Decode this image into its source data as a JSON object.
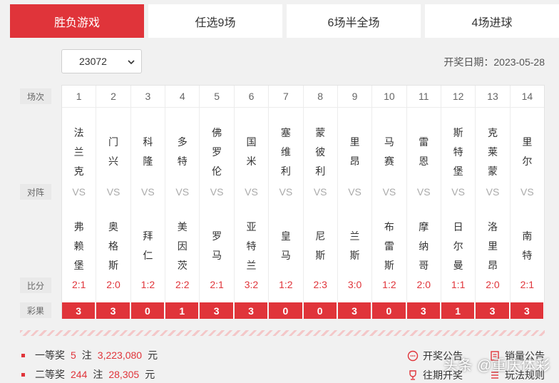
{
  "tabs": [
    {
      "label": "胜负游戏",
      "active": true
    },
    {
      "label": "任选9场",
      "active": false
    },
    {
      "label": "6场半全场",
      "active": false
    },
    {
      "label": "4场进球",
      "active": false
    }
  ],
  "issue": {
    "selected": "23072"
  },
  "draw_date": "开奖日期：2023-05-28",
  "row_labels": {
    "match_no": "场次",
    "matchup": "对阵",
    "score": "比分",
    "result": "彩果"
  },
  "vs_text": "VS",
  "matches": [
    {
      "no": "1",
      "home": "法兰克",
      "away": "弗赖堡",
      "score": "2:1",
      "result": "3"
    },
    {
      "no": "2",
      "home": "门兴",
      "away": "奥格斯",
      "score": "2:0",
      "result": "3"
    },
    {
      "no": "3",
      "home": "科隆",
      "away": "拜仁",
      "score": "1:2",
      "result": "0"
    },
    {
      "no": "4",
      "home": "多特",
      "away": "美因茨",
      "score": "2:2",
      "result": "1"
    },
    {
      "no": "5",
      "home": "佛罗伦",
      "away": "罗马",
      "score": "2:1",
      "result": "3"
    },
    {
      "no": "6",
      "home": "国米",
      "away": "亚特兰",
      "score": "3:2",
      "result": "3"
    },
    {
      "no": "7",
      "home": "塞维利",
      "away": "皇马",
      "score": "1:2",
      "result": "0"
    },
    {
      "no": "8",
      "home": "蒙彼利",
      "away": "尼斯",
      "score": "2:3",
      "result": "0"
    },
    {
      "no": "9",
      "home": "里昂",
      "away": "兰斯",
      "score": "3:0",
      "result": "3"
    },
    {
      "no": "10",
      "home": "马赛",
      "away": "布雷斯",
      "score": "1:2",
      "result": "0"
    },
    {
      "no": "11",
      "home": "雷恩",
      "away": "摩纳哥",
      "score": "2:0",
      "result": "3"
    },
    {
      "no": "12",
      "home": "斯特堡",
      "away": "日尔曼",
      "score": "1:1",
      "result": "1"
    },
    {
      "no": "13",
      "home": "克莱蒙",
      "away": "洛里昂",
      "score": "2:0",
      "result": "3"
    },
    {
      "no": "14",
      "home": "里尔",
      "away": "南特",
      "score": "2:1",
      "result": "3"
    }
  ],
  "prizes": [
    {
      "name": "一等奖",
      "count": "5",
      "unit_count": "注",
      "amount": "3,223,080",
      "currency": "元"
    },
    {
      "name": "二等奖",
      "count": "244",
      "unit_count": "注",
      "amount": "28,305",
      "currency": "元"
    }
  ],
  "links": {
    "announcement": "开奖公告",
    "sales": "销量公告",
    "history": "往期开奖",
    "rules": "玩法规则"
  },
  "watermark": "头条 @重庆体彩",
  "colors": {
    "accent": "#e0343a",
    "background": "#f1f1f1"
  }
}
